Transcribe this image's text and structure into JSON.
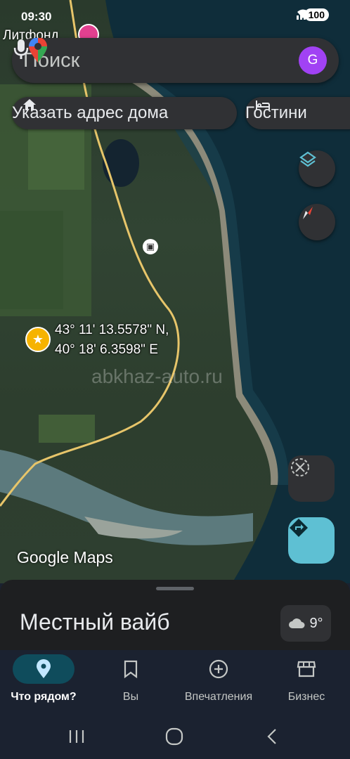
{
  "status_bar": {
    "time": "09:30",
    "battery": "100"
  },
  "map": {
    "top_place_label": "Литфонд",
    "coordinates_line1": "43° 11' 13.5578\" N,",
    "coordinates_line2": "40° 18' 6.3598\" E",
    "watermark": "abkhaz-auto.ru",
    "logo": "Google Maps"
  },
  "search": {
    "placeholder": "Поиск",
    "avatar_letter": "G"
  },
  "chips": [
    {
      "label": "Указать адрес дома",
      "icon": "home-icon"
    },
    {
      "label": "Гостини",
      "icon": "hotel-icon"
    }
  ],
  "sheet": {
    "title": "Местный вайб",
    "weather_temp": "9°",
    "weather_icon": "cloud-icon"
  },
  "bottom_nav": [
    {
      "label": "Что рядом?",
      "icon": "location-pin-icon",
      "active": true
    },
    {
      "label": "Вы",
      "icon": "bookmark-icon",
      "active": false
    },
    {
      "label": "Впечатления",
      "icon": "add-circle-icon",
      "active": false
    },
    {
      "label": "Бизнес",
      "icon": "storefront-icon",
      "active": false
    }
  ],
  "colors": {
    "accent": "#0f4c5c",
    "directions": "#5ec0d3",
    "star": "#f6b300",
    "avatar": "#a142f4"
  }
}
